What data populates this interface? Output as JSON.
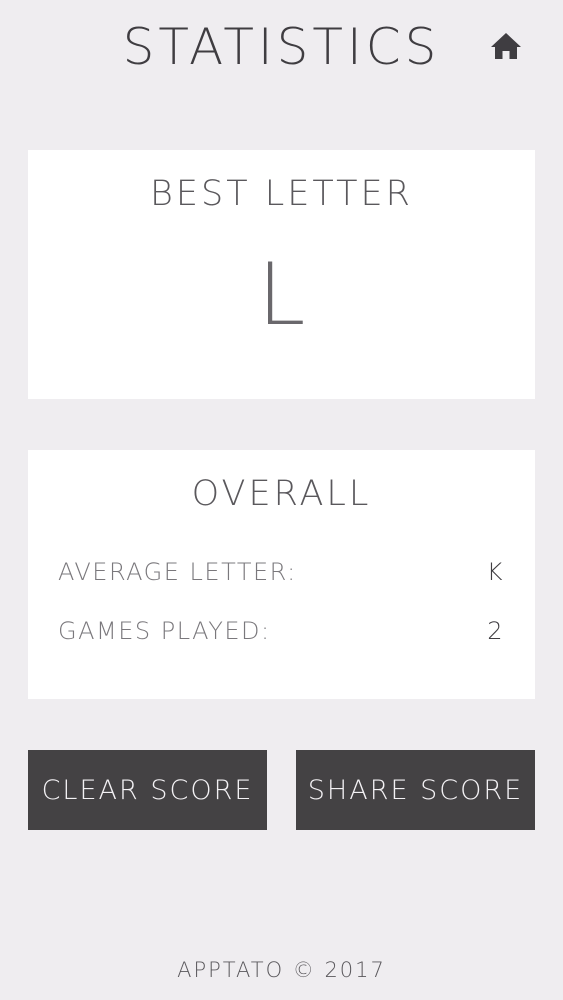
{
  "header": {
    "title": "STATISTICS",
    "home_icon": "home-icon"
  },
  "best": {
    "title": "BEST LETTER",
    "letter": "L"
  },
  "overall": {
    "title": "OVERALL",
    "average_label": "AVERAGE LETTER:",
    "average_value": "K",
    "games_label": "GAMES PLAYED:",
    "games_value": "2"
  },
  "buttons": {
    "clear": "CLEAR SCORE",
    "share": "SHARE SCORE"
  },
  "footer": {
    "text": "APPTATO © 2017"
  },
  "colors": {
    "background": "#efedf0",
    "card": "#ffffff",
    "button": "#444244"
  }
}
